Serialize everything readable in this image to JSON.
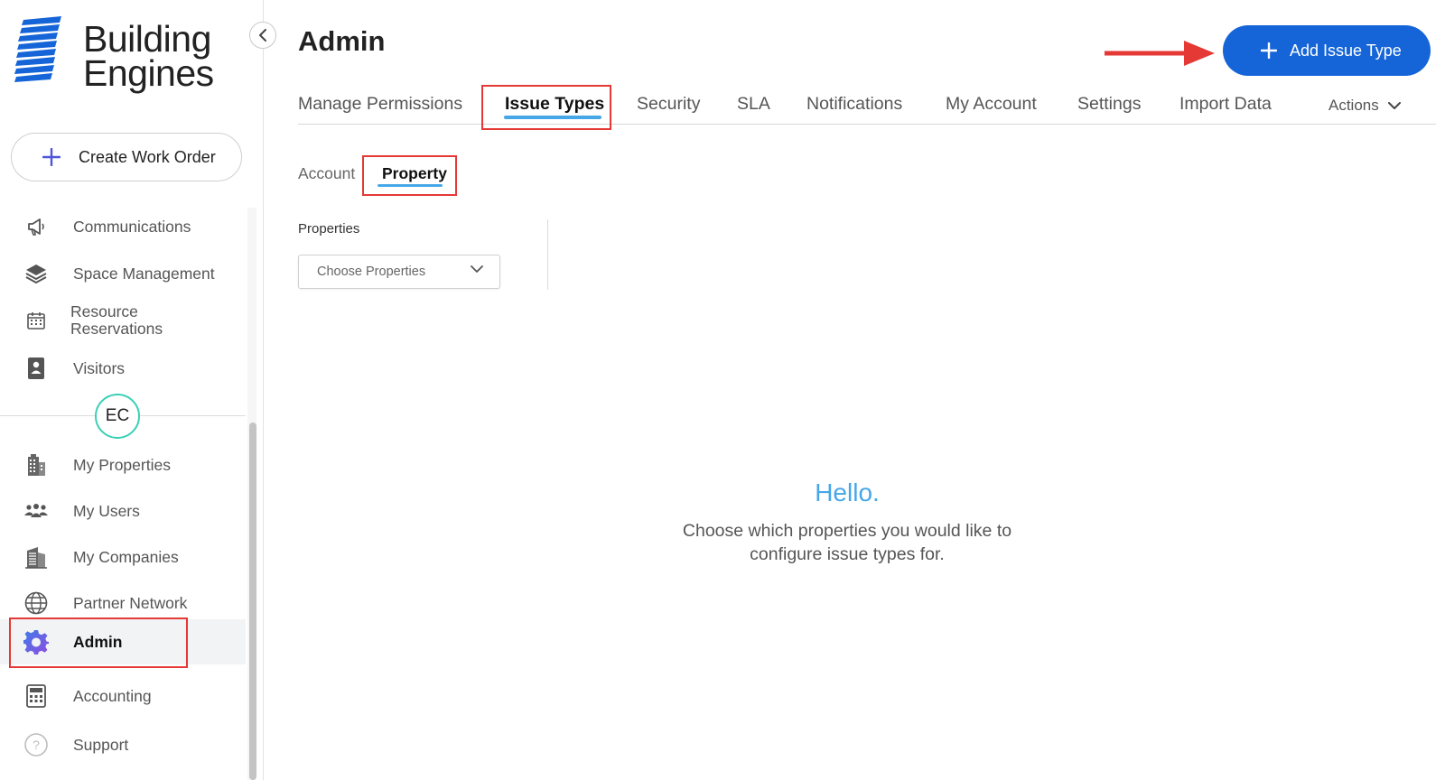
{
  "brand": {
    "line1": "Building",
    "line2": "Engines",
    "logo_color": "#1565d8"
  },
  "sidebar": {
    "create_button": "Create Work Order",
    "items": [
      {
        "label": "Communications",
        "icon": "megaphone-icon"
      },
      {
        "label": "Space Management",
        "icon": "layers-icon"
      },
      {
        "label": "Resource Reservations",
        "icon": "calendar-icon"
      },
      {
        "label": "Visitors",
        "icon": "id-badge-icon"
      },
      {
        "label": "My Properties",
        "icon": "building-icon"
      },
      {
        "label": "My Users",
        "icon": "users-icon"
      },
      {
        "label": "My Companies",
        "icon": "office-building-icon"
      },
      {
        "label": "Partner Network",
        "icon": "globe-icon"
      },
      {
        "label": "Admin",
        "icon": "gear-icon",
        "active": true
      },
      {
        "label": "Accounting",
        "icon": "calculator-icon"
      },
      {
        "label": "Support",
        "icon": "help-icon"
      }
    ],
    "avatar_initials": "EC",
    "avatar_color": "#3ad0b5"
  },
  "header": {
    "title": "Admin",
    "add_button": "Add Issue Type",
    "accent": "#1565d8",
    "annotation_color": "#e53935"
  },
  "tabs": [
    {
      "label": "Manage Permissions"
    },
    {
      "label": "Issue Types",
      "active": true
    },
    {
      "label": "Security"
    },
    {
      "label": "SLA"
    },
    {
      "label": "Notifications"
    },
    {
      "label": "My Account"
    },
    {
      "label": "Settings"
    },
    {
      "label": "Import Data"
    }
  ],
  "actions_label": "Actions",
  "subtabs": [
    {
      "label": "Account"
    },
    {
      "label": "Property",
      "active": true
    }
  ],
  "filter": {
    "label": "Properties",
    "placeholder": "Choose Properties"
  },
  "empty_state": {
    "title": "Hello.",
    "line1": "Choose which properties you would like to",
    "line2": "configure issue types for.",
    "title_color": "#46a7e8"
  }
}
